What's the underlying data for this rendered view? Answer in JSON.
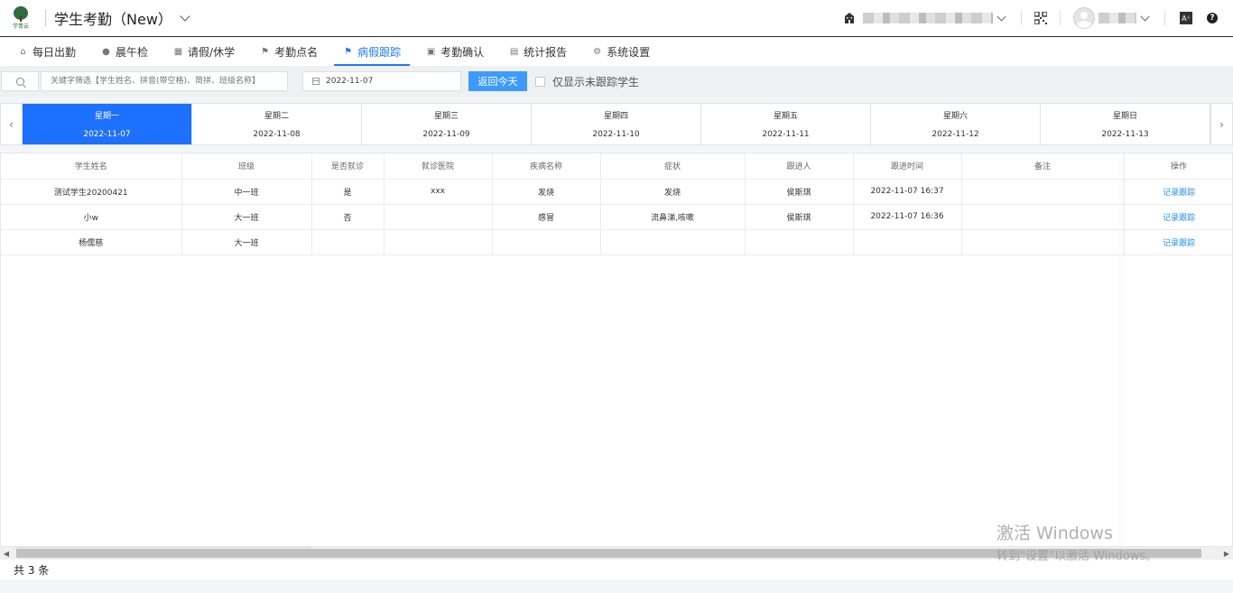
{
  "header": {
    "logo_text": "学青云",
    "app_title": "学生考勤（New）"
  },
  "nav": {
    "items": [
      {
        "label": "每日出勤",
        "icon": "home-icon"
      },
      {
        "label": "晨午检",
        "icon": "location-pin-icon"
      },
      {
        "label": "请假/休学",
        "icon": "grid-icon"
      },
      {
        "label": "考勤点名",
        "icon": "flag-icon"
      },
      {
        "label": "病假跟踪",
        "icon": "flag-icon",
        "active": true
      },
      {
        "label": "考勤确认",
        "icon": "clipboard-icon"
      },
      {
        "label": "统计报告",
        "icon": "report-icon"
      },
      {
        "label": "系统设置",
        "icon": "gear-icon"
      }
    ]
  },
  "filter": {
    "search_placeholder": "关键字筛选【学生姓名、拼音(带空格)、简拼、班级名称】",
    "date_value": "2022-11-07",
    "today_button": "返回今天",
    "untracked_only_label": "仅显示未跟踪学生"
  },
  "week": {
    "days": [
      {
        "weekday": "星期一",
        "date": "2022-11-07",
        "active": true
      },
      {
        "weekday": "星期二",
        "date": "2022-11-08"
      },
      {
        "weekday": "星期三",
        "date": "2022-11-09"
      },
      {
        "weekday": "星期四",
        "date": "2022-11-10"
      },
      {
        "weekday": "星期五",
        "date": "2022-11-11"
      },
      {
        "weekday": "星期六",
        "date": "2022-11-12"
      },
      {
        "weekday": "星期日",
        "date": "2022-11-13"
      }
    ]
  },
  "table": {
    "columns": [
      "学生姓名",
      "班级",
      "是否就诊",
      "就诊医院",
      "疾病名称",
      "症状",
      "跟进人",
      "跟进时间",
      "备注",
      "操作"
    ],
    "rows": [
      [
        "测试学生20200421",
        "中一班",
        "是",
        "xxx",
        "发烧",
        "发烧",
        "侯斯琪",
        "2022-11-07 16:37",
        "",
        "记录跟踪"
      ],
      [
        "小w",
        "大一班",
        "否",
        "",
        "感冒",
        "流鼻涕,咳嗽",
        "侯斯琪",
        "2022-11-07 16:36",
        "",
        "记录跟踪"
      ],
      [
        "杨儒慈",
        "大一班",
        "",
        "",
        "",
        "",
        "",
        "",
        "",
        "记录跟踪"
      ]
    ]
  },
  "footer": {
    "total_label": "共 3 条"
  },
  "watermark": {
    "line1": "激活 Windows",
    "line2": "转到\"设置\"以激活 Windows。"
  }
}
